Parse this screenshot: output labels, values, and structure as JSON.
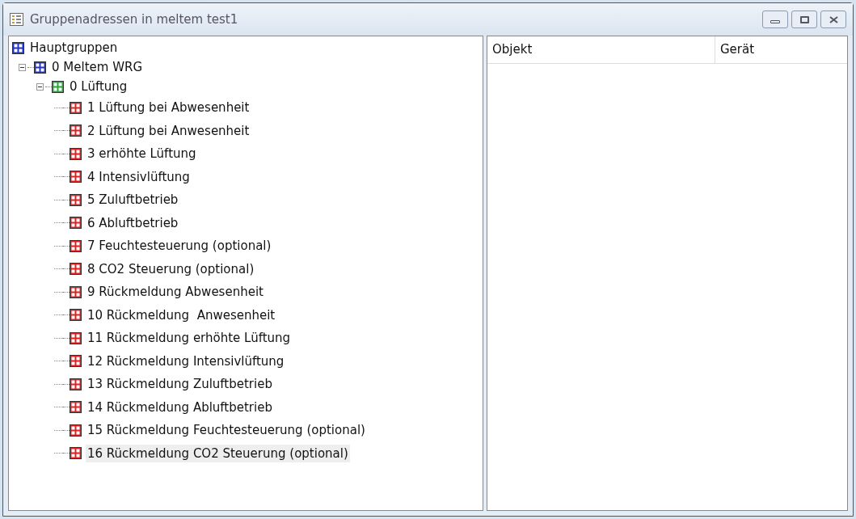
{
  "window": {
    "title": "Gruppenadressen in meltem test1"
  },
  "tree": [
    {
      "label": "Hauptgruppen",
      "color": "#2233cc",
      "children": [
        {
          "label": "0 Meltem WRG",
          "color": "#2233cc",
          "expanded": true,
          "children": [
            {
              "label": "0 Lüftung",
              "color": "#22aa33",
              "expanded": true,
              "children": [
                {
                  "label": "1 Lüftung bei Abwesenheit",
                  "color": "#dd2222",
                  "selected": false
                },
                {
                  "label": "2 Lüftung bei Anwesenheit",
                  "color": "#dd2222",
                  "selected": false
                },
                {
                  "label": "3 erhöhte Lüftung",
                  "color": "#dd2222",
                  "selected": false
                },
                {
                  "label": "4 Intensivlüftung",
                  "color": "#dd2222",
                  "selected": false
                },
                {
                  "label": "5 Zuluftbetrieb",
                  "color": "#dd2222",
                  "selected": false
                },
                {
                  "label": "6 Abluftbetrieb",
                  "color": "#dd2222",
                  "selected": false
                },
                {
                  "label": "7 Feuchtesteuerung (optional)",
                  "color": "#dd2222",
                  "selected": false
                },
                {
                  "label": "8 CO2 Steuerung (optional)",
                  "color": "#dd2222",
                  "selected": false
                },
                {
                  "label": "9 Rückmeldung Abwesenheit",
                  "color": "#dd2222",
                  "selected": false
                },
                {
                  "label": "10 Rückmeldung  Anwesenheit",
                  "color": "#dd2222",
                  "selected": false
                },
                {
                  "label": "11 Rückmeldung erhöhte Lüftung",
                  "color": "#dd2222",
                  "selected": false
                },
                {
                  "label": "12 Rückmeldung Intensivlüftung",
                  "color": "#dd2222",
                  "selected": false
                },
                {
                  "label": "13 Rückmeldung Zuluftbetrieb",
                  "color": "#dd2222",
                  "selected": false
                },
                {
                  "label": "14 Rückmeldung Abluftbetrieb",
                  "color": "#dd2222",
                  "selected": false
                },
                {
                  "label": "15 Rückmeldung Feuchtesteuerung (optional)",
                  "color": "#dd2222",
                  "selected": false
                },
                {
                  "label": "16 Rückmeldung CO2 Steuerung (optional)",
                  "color": "#dd2222",
                  "selected": true
                }
              ]
            }
          ]
        }
      ]
    }
  ],
  "table": {
    "columns": [
      "Objekt",
      "Gerät"
    ]
  }
}
